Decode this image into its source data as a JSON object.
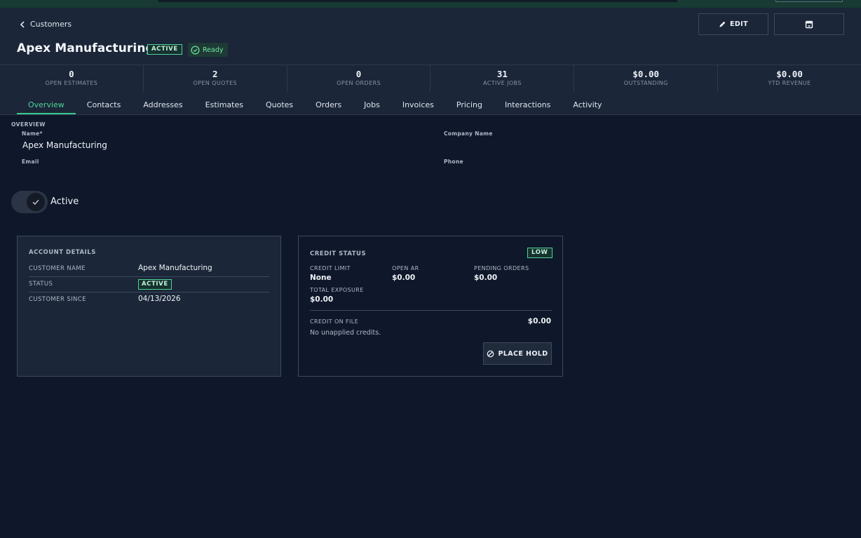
{
  "nav": {
    "back_label": "Customers"
  },
  "customer": {
    "name": "Apex Manufacturing",
    "status_badge": "ACTIVE",
    "ready_label": "Ready"
  },
  "actions": {
    "edit_label": "EDIT",
    "archive_icon": "archive-icon"
  },
  "stats": [
    {
      "value": "0",
      "label": "OPEN ESTIMATES"
    },
    {
      "value": "2",
      "label": "OPEN QUOTES"
    },
    {
      "value": "0",
      "label": "OPEN ORDERS"
    },
    {
      "value": "31",
      "label": "ACTIVE JOBS"
    },
    {
      "value": "$0.00",
      "label": "OUTSTANDING"
    },
    {
      "value": "$0.00",
      "label": "YTD REVENUE"
    }
  ],
  "tabs": [
    {
      "label": "Overview",
      "active": true
    },
    {
      "label": "Contacts"
    },
    {
      "label": "Addresses"
    },
    {
      "label": "Estimates"
    },
    {
      "label": "Quotes"
    },
    {
      "label": "Orders"
    },
    {
      "label": "Jobs"
    },
    {
      "label": "Invoices"
    },
    {
      "label": "Pricing"
    },
    {
      "label": "Interactions"
    },
    {
      "label": "Activity"
    }
  ],
  "overview": {
    "section_label": "OVERVIEW",
    "name_label": "Name*",
    "name_value": "Apex Manufacturing",
    "company_label": "Company Name",
    "company_value": "",
    "email_label": "Email",
    "email_value": "",
    "phone_label": "Phone",
    "phone_value": "",
    "toggle_label": "Active",
    "toggle_on": true
  },
  "account_details": {
    "title": "ACCOUNT DETAILS",
    "rows": [
      {
        "key": "CUSTOMER NAME",
        "value": "Apex Manufacturing"
      },
      {
        "key": "STATUS",
        "value": "ACTIVE"
      },
      {
        "key": "CUSTOMER SINCE",
        "value": "04/13/2026"
      }
    ]
  },
  "credit": {
    "title": "CREDIT STATUS",
    "level_badge": "LOW",
    "credit_limit_label": "CREDIT LIMIT",
    "credit_limit_value": "None",
    "open_ar_label": "OPEN AR",
    "open_ar_value": "$0.00",
    "pending_orders_label": "PENDING ORDERS",
    "pending_orders_value": "$0.00",
    "total_exposure_label": "TOTAL EXPOSURE",
    "total_exposure_value": "$0.00",
    "credit_on_file_label": "CREDIT ON FILE",
    "credit_on_file_value": "$0.00",
    "note": "No unapplied credits.",
    "hold_button_label": "PLACE HOLD"
  },
  "colors": {
    "background": "#0f182a",
    "panel": "#1b2638",
    "accent": "#3ac88c",
    "border": "#3b4a60"
  }
}
